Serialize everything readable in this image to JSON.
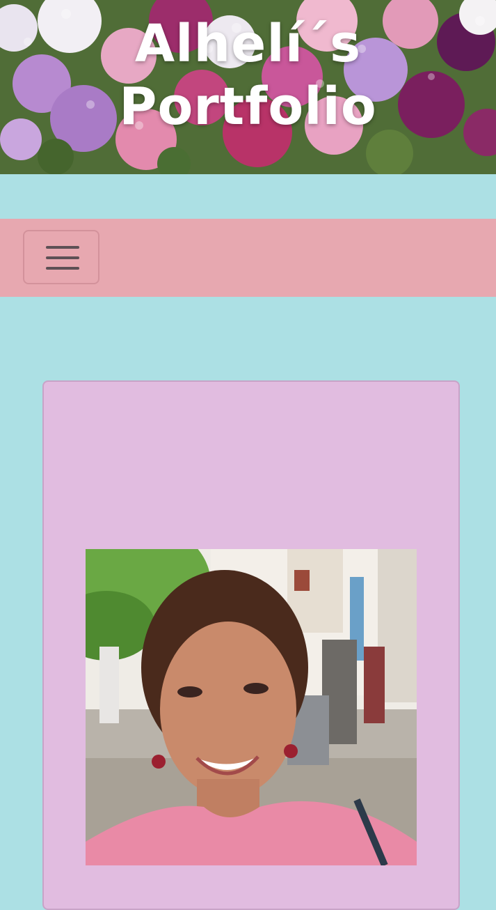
{
  "header": {
    "title": "Alhelí´s Portfolio",
    "background_image": "flower-bouquet-banner"
  },
  "navbar": {
    "toggle_icon": "hamburger-menu-icon"
  },
  "profile": {
    "photo": "portrait-photo"
  },
  "colors": {
    "page_background": "#ace0e4",
    "navbar_background": "#e7a8b0",
    "card_background": "#e1bce0",
    "title_text": "#ffffff"
  }
}
